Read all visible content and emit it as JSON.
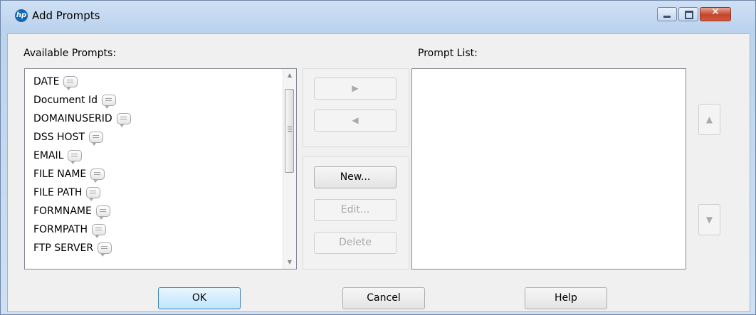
{
  "window": {
    "title": "Add Prompts",
    "logo_text": "hp"
  },
  "available": {
    "label": "Available Prompts:",
    "items": [
      "DATE",
      "Document Id",
      "DOMAINUSERID",
      "DSS HOST",
      "EMAIL",
      "FILE NAME",
      "FILE PATH",
      "FORMNAME",
      "FORMPATH",
      "FTP SERVER"
    ]
  },
  "prompt_list": {
    "label": "Prompt List:",
    "items": []
  },
  "buttons": {
    "new": "New...",
    "edit": "Edit...",
    "delete": "Delete",
    "ok": "OK",
    "cancel": "Cancel",
    "help": "Help"
  },
  "icons": {
    "item_icon": "speech-bubble-icon",
    "add": "arrow-right-icon",
    "remove": "arrow-left-icon",
    "move_up": "arrow-up-icon",
    "move_down": "arrow-down-icon"
  },
  "colors": {
    "titlebar": "#bcd3ee",
    "close_button": "#c4442a",
    "default_button": "#bee6fd"
  }
}
